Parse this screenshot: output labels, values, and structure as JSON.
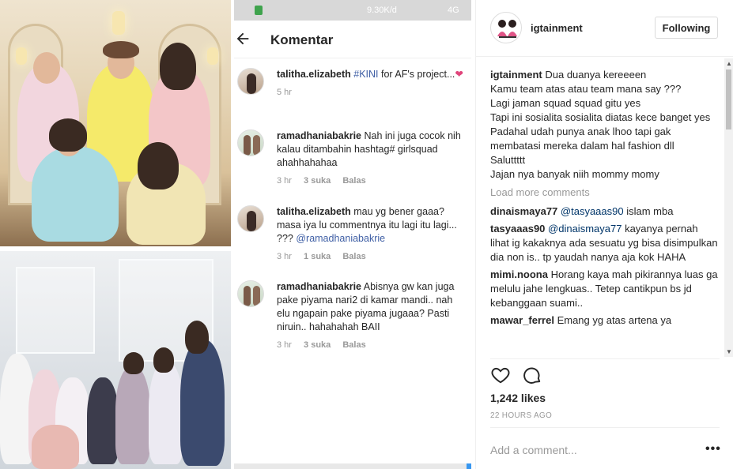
{
  "phone": {
    "statusbar": {
      "speed": "9.30K/d",
      "signal": "4G"
    },
    "title": "Komentar",
    "comments": [
      {
        "user": "talitha.elizabeth",
        "tag": "#KINI",
        "text": " for AF's project...",
        "heart": "❤",
        "time": "5 hr",
        "likes": "",
        "reply": ""
      },
      {
        "user": "ramadhaniabakrie",
        "tag": "",
        "text": " Nah ini juga cocok nih kalau ditambahin hashtag# girlsquad ahahhahahaa",
        "heart": "",
        "time": "3 hr",
        "likes": "3 suka",
        "reply": "Balas"
      },
      {
        "user": "talitha.elizabeth",
        "tag": "",
        "text": " mau yg bener gaaa? masa iya lu commentnya itu lagi itu lagi... ??? ",
        "mention": "@ramadhaniabakrie",
        "heart": "",
        "time": "3 hr",
        "likes": "1 suka",
        "reply": "Balas"
      },
      {
        "user": "ramadhaniabakrie",
        "tag": "",
        "text": " Abisnya gw kan juga pake piyama nari2 di kamar mandi.. nah elu ngapain pake piyama jugaaa? Pasti niruin.. hahahahah BAII",
        "heart": "",
        "time": "3 hr",
        "likes": "3 suka",
        "reply": "Balas"
      }
    ]
  },
  "panel": {
    "username": "igtainment",
    "follow_label": "Following",
    "caption_user": "igtainment",
    "caption_lines": [
      "Dua duanya kereeeen",
      "Kamu team atas atau team mana say ???",
      "Lagi jaman squad squad gitu yes",
      "Tapi ini sosialita sosialita diatas kece banget yes",
      "Padahal udah punya anak lhoo tapi gak membatasi mereka dalam hal fashion dll",
      "Saluttttt",
      "Jajan nya banyak niih mommy momy"
    ],
    "load_more": "Load more comments",
    "comments": [
      {
        "user": "dinaismaya77",
        "mention": "@tasyaaas90",
        "text": " islam mba"
      },
      {
        "user": "tasyaaas90",
        "mention": "@dinaismaya77",
        "text": " kayanya pernah lihat ig kakaknya ada sesuatu yg bisa disimpulkan dia non is.. tp yaudah nanya aja kok HAHA"
      },
      {
        "user": "mimi.noona",
        "mention": "",
        "text": " Horang kaya mah pikirannya luas ga melulu jahe lengkuas.. Tetep cantikpun bs jd kebanggaan suami.."
      },
      {
        "user": "mawar_ferrel",
        "mention": "",
        "text": " Emang yg atas artena ya"
      }
    ],
    "likes": "1,242 likes",
    "time": "22 HOURS AGO",
    "add_comment_placeholder": "Add a comment...",
    "more_label": "•••"
  }
}
